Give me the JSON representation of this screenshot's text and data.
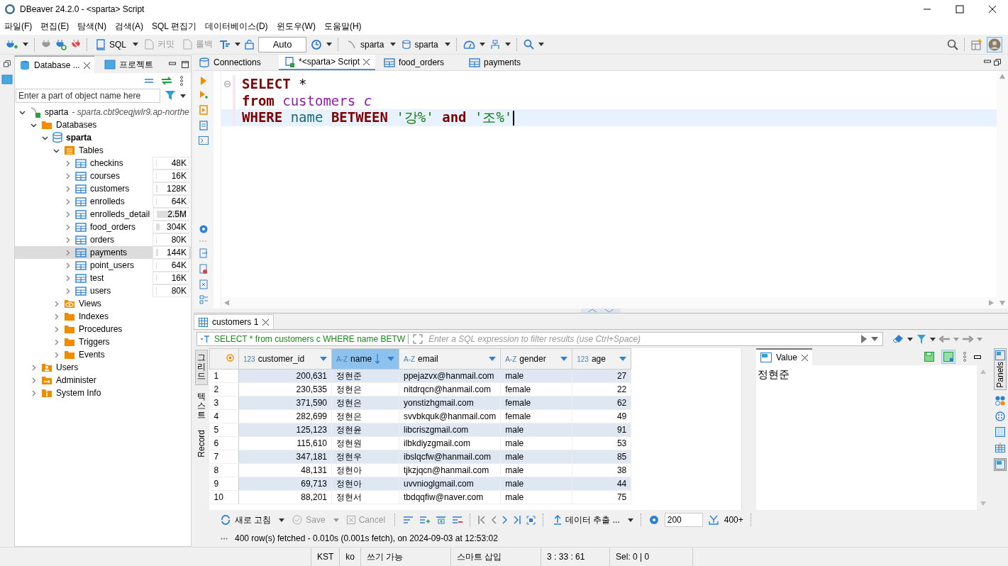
{
  "window": {
    "title": "DBeaver 24.2.0 - <sparta> Script"
  },
  "menu": [
    "파일(F)",
    "편집(E)",
    "탐색(N)",
    "검색(A)",
    "SQL 편집기",
    "데이터베이스(D)",
    "윈도우(W)",
    "도움말(H)"
  ],
  "toolbar": {
    "sql": "SQL",
    "commit": {
      "label": "커밋",
      "disabled": true
    },
    "rollback": {
      "label": "롤백",
      "disabled": true
    },
    "transaction_mode": "Auto",
    "datasource": "sparta",
    "schema": "sparta"
  },
  "navigator": {
    "tabs": [
      {
        "label": "Database ...",
        "selected": true
      },
      {
        "label": "프로젝트",
        "selected": false
      }
    ],
    "filter": {
      "placeholder": "Enter a part of object name here"
    },
    "tree": [
      {
        "label": "sparta",
        "detail": "- sparta.cbt9ceqjwlr9.ap-northe",
        "kind": "connection",
        "expanded": true,
        "children": [
          {
            "label": "Databases",
            "kind": "folder",
            "expanded": true,
            "children": [
              {
                "label": "sparta",
                "kind": "database",
                "expanded": true,
                "children": [
                  {
                    "label": "Tables",
                    "kind": "tables",
                    "expanded": true,
                    "children": [
                      {
                        "label": "checkins",
                        "kind": "table",
                        "expanded": false,
                        "size": "48K",
                        "level": 0.02,
                        "selected": false
                      },
                      {
                        "label": "courses",
                        "kind": "table",
                        "expanded": false,
                        "size": "16K",
                        "level": 0.01,
                        "selected": false
                      },
                      {
                        "label": "customers",
                        "kind": "table",
                        "expanded": false,
                        "size": "128K",
                        "level": 0.04,
                        "selected": false
                      },
                      {
                        "label": "enrolleds",
                        "kind": "table",
                        "expanded": false,
                        "size": "64K",
                        "level": 0.02,
                        "selected": false
                      },
                      {
                        "label": "enrolleds_detail",
                        "kind": "table",
                        "expanded": false,
                        "size": "2.5M",
                        "level": 1,
                        "selected": false
                      },
                      {
                        "label": "food_orders",
                        "kind": "table",
                        "expanded": false,
                        "size": "304K",
                        "level": 0.12,
                        "selected": false
                      },
                      {
                        "label": "orders",
                        "kind": "table",
                        "expanded": false,
                        "size": "80K",
                        "level": 0.03,
                        "selected": false
                      },
                      {
                        "label": "payments",
                        "kind": "table",
                        "expanded": false,
                        "size": "144K",
                        "level": 0.06,
                        "selected": true
                      },
                      {
                        "label": "point_users",
                        "kind": "table",
                        "expanded": false,
                        "size": "64K",
                        "level": 0.02,
                        "selected": false
                      },
                      {
                        "label": "test",
                        "kind": "table",
                        "expanded": false,
                        "size": "16K",
                        "level": 0.01,
                        "selected": false
                      },
                      {
                        "label": "users",
                        "kind": "table",
                        "expanded": false,
                        "size": "80K",
                        "level": 0.03,
                        "selected": false
                      }
                    ]
                  },
                  {
                    "label": "Views",
                    "kind": "views",
                    "expanded": false
                  },
                  {
                    "label": "Indexes",
                    "kind": "folder",
                    "expanded": false
                  },
                  {
                    "label": "Procedures",
                    "kind": "folder",
                    "expanded": false
                  },
                  {
                    "label": "Triggers",
                    "kind": "folder",
                    "expanded": false
                  },
                  {
                    "label": "Events",
                    "kind": "folder",
                    "expanded": false
                  }
                ]
              }
            ]
          },
          {
            "label": "Users",
            "kind": "users",
            "expanded": false
          },
          {
            "label": "Administer",
            "kind": "admin",
            "expanded": false
          },
          {
            "label": "System Info",
            "kind": "info",
            "expanded": false
          }
        ]
      }
    ]
  },
  "editor_tabs": [
    {
      "label": "Connections",
      "kind": "connections",
      "selected": false
    },
    {
      "label": "*<sparta> Script",
      "kind": "script",
      "selected": true
    },
    {
      "label": "food_orders",
      "kind": "table",
      "selected": false
    },
    {
      "label": "payments",
      "kind": "table",
      "selected": false
    }
  ],
  "sql_lines": [
    {
      "current": false,
      "tokens": [
        {
          "kind": "keyword",
          "text": "SELECT"
        },
        {
          "kind": "plain",
          "text": "*"
        }
      ]
    },
    {
      "current": false,
      "tokens": [
        {
          "kind": "keyword",
          "text": "from"
        },
        {
          "kind": "table",
          "text": "customers"
        },
        {
          "kind": "alias",
          "text": "c"
        }
      ]
    },
    {
      "current": true,
      "tokens": [
        {
          "kind": "keyword",
          "text": "WHERE"
        },
        {
          "kind": "column",
          "text": "name"
        },
        {
          "kind": "keyword",
          "text": "BETWEEN"
        },
        {
          "kind": "string",
          "text": "'강%'"
        },
        {
          "kind": "keyword",
          "text": "and"
        },
        {
          "kind": "string",
          "text": "'조%'"
        }
      ]
    }
  ],
  "results": {
    "tab": "customers 1",
    "query": "SELECT * from customers c WHERE name BETW",
    "filter": {
      "placeholder": "Enter a SQL expression to filter results (use Ctrl+Space)"
    },
    "view_tabs": [
      {
        "label": "그리드",
        "kind": "cjk",
        "selected": true
      },
      {
        "label": "텍스트",
        "kind": "cjk",
        "selected": false
      },
      {
        "label": "Record",
        "kind": "latin",
        "selected": false
      }
    ],
    "columns": [
      {
        "type_label": "123",
        "name": "customer_id",
        "kind": "number",
        "sorted": false
      },
      {
        "type_label": "A-Z",
        "name": "name",
        "kind": "text",
        "sorted": true
      },
      {
        "type_label": "A-Z",
        "name": "email",
        "kind": "text",
        "sorted": false
      },
      {
        "type_label": "A-Z",
        "name": "gender",
        "kind": "text",
        "sorted": false
      },
      {
        "type_label": "123",
        "name": "age",
        "kind": "number",
        "sorted": false
      }
    ],
    "rows": [
      {
        "number": "1",
        "cells": [
          "200,631",
          "정현준",
          "ppejazvx@hanmail.com",
          "male",
          "27"
        ]
      },
      {
        "number": "2",
        "cells": [
          "230,535",
          "정현은",
          "nitdrqcn@hanmail.com",
          "female",
          "22"
        ]
      },
      {
        "number": "3",
        "cells": [
          "371,590",
          "정현은",
          "yonstizhgmail.com",
          "female",
          "62"
        ]
      },
      {
        "number": "4",
        "cells": [
          "282,699",
          "정현은",
          "svvbkquk@hanmail.com",
          "female",
          "49"
        ]
      },
      {
        "number": "5",
        "cells": [
          "125,123",
          "정현윤",
          "libcriszgmail.com",
          "male",
          "91"
        ]
      },
      {
        "number": "6",
        "cells": [
          "115,610",
          "정현원",
          "ilbkdiyzgmail.com",
          "male",
          "53"
        ]
      },
      {
        "number": "7",
        "cells": [
          "347,181",
          "정현우",
          "ibslqcfw@hanmail.com",
          "male",
          "85"
        ]
      },
      {
        "number": "8",
        "cells": [
          "48,131",
          "정현아",
          "tjkzjqcn@hanmail.com",
          "male",
          "38"
        ]
      },
      {
        "number": "9",
        "cells": [
          "69,713",
          "정현아",
          "uvvnioglgmail.com",
          "male",
          "44"
        ]
      },
      {
        "number": "10",
        "cells": [
          "88,201",
          "정현서",
          "tbdqqfiw@naver.com",
          "male",
          "75"
        ]
      }
    ],
    "value_panel": {
      "tab": "Value",
      "value": "정현준"
    },
    "panels_label": "Panels",
    "toolbar": {
      "refresh": "새로 고침",
      "save": {
        "label": "Save",
        "disabled": true
      },
      "cancel": {
        "label": "Cancel",
        "disabled": true
      },
      "export": "데이터 추출 ...",
      "fetch_size": "200",
      "fetch_all": "400+"
    },
    "status": "400 row(s) fetched - 0.010s (0.001s fetch), on 2024-09-03 at 12:53:02"
  },
  "status_bar": [
    "KST",
    "ko",
    "쓰기 가능",
    "스마트 삽입",
    "3 : 33 : 61",
    "Sel: 0 | 0"
  ]
}
